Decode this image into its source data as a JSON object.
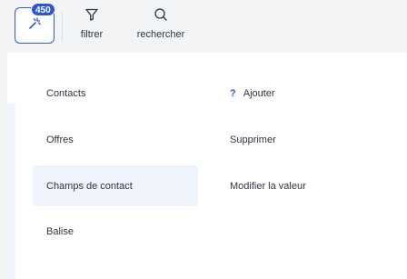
{
  "toolbar": {
    "badge_count": "450",
    "filter_label": "filtrer",
    "search_label": "rechercher"
  },
  "menu": {
    "left_items": [
      {
        "label": "Contacts"
      },
      {
        "label": "Offres"
      },
      {
        "label": "Champs de contact",
        "active": true
      },
      {
        "label": "Balise"
      }
    ],
    "right_items": [
      {
        "label": "Ajouter",
        "icon": "question-icon"
      },
      {
        "label": "Supprimer"
      },
      {
        "label": "Modifier la valeur"
      }
    ]
  },
  "colors": {
    "accent": "#2b57d6",
    "active_bg": "#eef3fc"
  }
}
